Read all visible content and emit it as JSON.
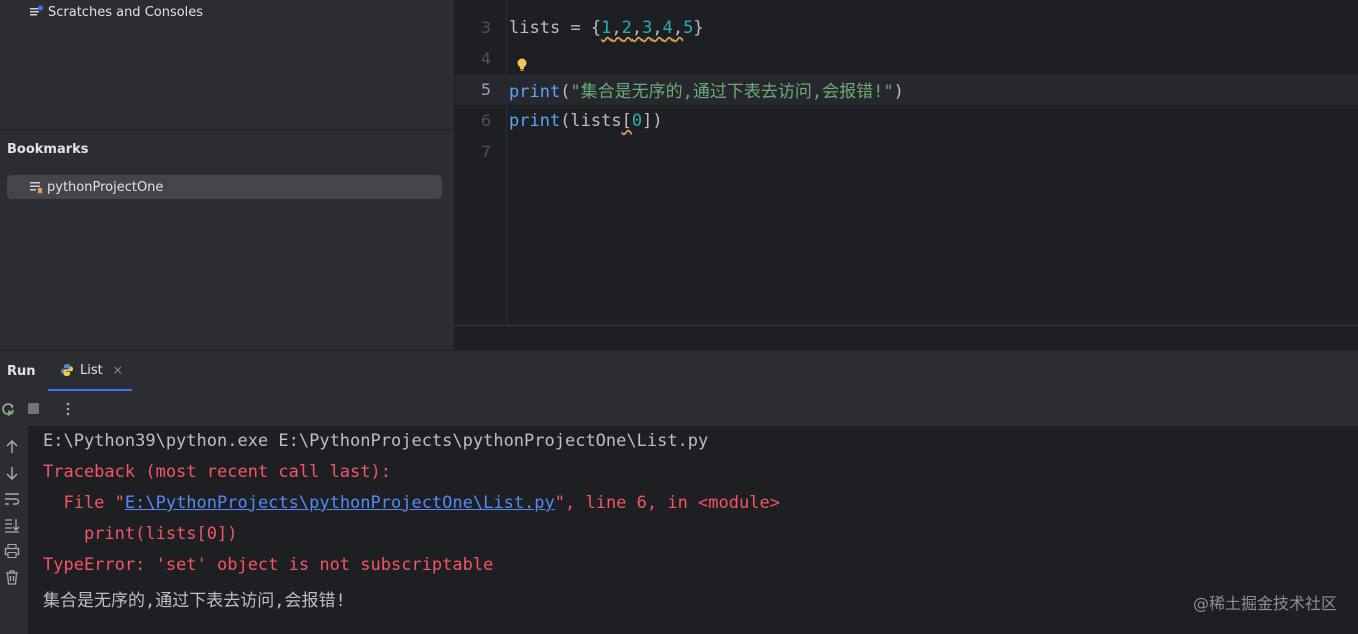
{
  "project_panel": {
    "scratches_label": "Scratches and Consoles",
    "bookmarks_title": "Bookmarks",
    "bookmark_item": "pythonProjectOne"
  },
  "editor": {
    "lines": [
      {
        "number": "3",
        "text": "lists = {1,2,3,4,5}"
      },
      {
        "number": "4",
        "text": ""
      },
      {
        "number": "5",
        "text": "print(\"集合是无序的,通过下表去访问,会报错!\")"
      },
      {
        "number": "6",
        "text": "print(lists[0])"
      },
      {
        "number": "7",
        "text": ""
      }
    ],
    "current_line": "5"
  },
  "run_panel": {
    "title": "Run",
    "tab_label": "List",
    "tab_close": "×"
  },
  "console": {
    "command": "E:\\Python39\\python.exe E:\\PythonProjects\\pythonProjectOne\\List.py",
    "traceback_header": "Traceback (most recent call last):",
    "file_prefix": "  File \"",
    "file_link": "E:\\PythonProjects\\pythonProjectOne\\List.py",
    "file_suffix": "\", line 6, in <module>",
    "code_line": "    print(lists[0])",
    "error": "TypeError: 'set' object is not subscriptable",
    "output": "集合是无序的,通过下表去访问,会报错!"
  },
  "watermark": "@稀土掘金技术社区",
  "icons": {
    "toolbar": [
      "rerun-icon",
      "stop-icon",
      "more-icon"
    ],
    "side": [
      "up-arrow-icon",
      "down-arrow-icon",
      "soft-wrap-icon",
      "scroll-to-end-icon",
      "print-icon",
      "trash-icon"
    ]
  }
}
